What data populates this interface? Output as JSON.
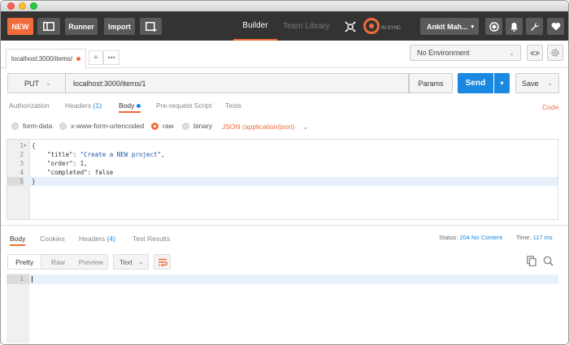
{
  "window": {
    "title": ""
  },
  "toolbar": {
    "new_label": "NEW",
    "runner_label": "Runner",
    "import_label": "Import",
    "builder_tab": "Builder",
    "team_library_tab": "Team Library",
    "sync_status": "IN SYNC",
    "user_name": "Ankit Mah...",
    "icons": [
      "sidebar-icon",
      "new-window-icon",
      "satellite-icon",
      "sync-icon",
      "globe-icon",
      "bell-icon",
      "wrench-icon",
      "heart-icon"
    ]
  },
  "tabs": {
    "request_tab": "localhost:3000/items/",
    "has_unsaved_changes": true,
    "add_label": "+",
    "more_label": "•••"
  },
  "environment": {
    "selected": "No Environment"
  },
  "request": {
    "method": "PUT",
    "url": "localhost:3000/items/1",
    "params_label": "Params",
    "send_label": "Send",
    "save_label": "Save"
  },
  "request_tabs": {
    "authorization": "Authorization",
    "headers": "Headers",
    "headers_count": "(1)",
    "body": "Body",
    "prerequest": "Pre-request Script",
    "tests": "Tests",
    "code": "Code"
  },
  "body_types": {
    "form_data": "form-data",
    "urlencoded": "x-www-form-urlencoded",
    "raw": "raw",
    "binary": "binary",
    "selected": "raw",
    "content_type": "JSON (application/json)"
  },
  "editor": {
    "lines": [
      {
        "n": "1",
        "fold": "▾",
        "text": "{"
      },
      {
        "n": "2",
        "fold": "",
        "key": "\"title\"",
        "sep": ": ",
        "value": "\"Create a NEW project\"",
        "tail": ","
      },
      {
        "n": "3",
        "fold": "",
        "key": "\"order\"",
        "sep": ": ",
        "value": "1",
        "tail": ","
      },
      {
        "n": "4",
        "fold": "",
        "key": "\"completed\"",
        "sep": ": ",
        "value": "false",
        "tail": ""
      },
      {
        "n": "5",
        "fold": "",
        "text": "}"
      }
    ]
  },
  "response": {
    "tabs": {
      "body": "Body",
      "cookies": "Cookies",
      "headers": "Headers",
      "headers_count": "(4)",
      "test_results": "Test Results"
    },
    "status_label": "Status:",
    "status_value": "204 No Content",
    "time_label": "Time:",
    "time_value": "117 ms",
    "formats": {
      "pretty": "Pretty",
      "raw": "Raw",
      "preview": "Preview"
    },
    "text_select": "Text",
    "line_number": "1"
  },
  "colors": {
    "accent": "#f26b3a",
    "primary": "#1a88e0",
    "toolbar_bg": "#333333"
  }
}
